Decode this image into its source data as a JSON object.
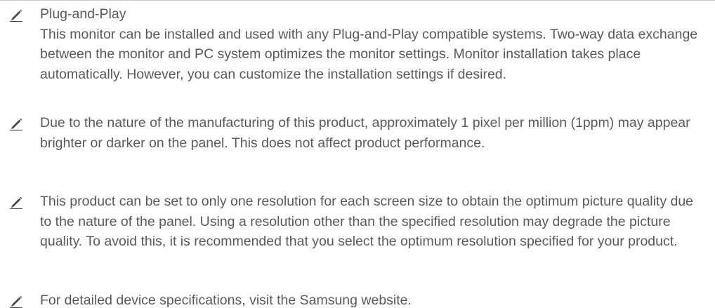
{
  "notes": [
    {
      "icon": "pencil-icon",
      "heading": "Plug-and-Play",
      "body": "This monitor can be installed and used with any Plug-and-Play compatible systems. Two-way data exchange between the monitor and PC system optimizes the monitor settings. Monitor installation takes place automatically. However, you can customize the installation settings if desired."
    },
    {
      "icon": "pencil-icon",
      "body": "Due to the nature of the manufacturing of this product, approximately 1 pixel per million (1ppm) may appear brighter or darker on the panel. This does not affect product performance."
    },
    {
      "icon": "pencil-icon",
      "body": "This product can be set to only one resolution for each screen size to obtain the optimum picture quality due to the nature of the panel. Using a resolution other than the specified resolution may degrade the picture quality. To avoid this, it is recommended that you select the optimum resolution specified for your product."
    },
    {
      "icon": "pencil-icon",
      "body": "For detailed device specifications, visit the Samsung website."
    }
  ],
  "colors": {
    "text": "#5a5a5a",
    "icon": "#4a4a4a",
    "rule": "#c8c8c8"
  }
}
